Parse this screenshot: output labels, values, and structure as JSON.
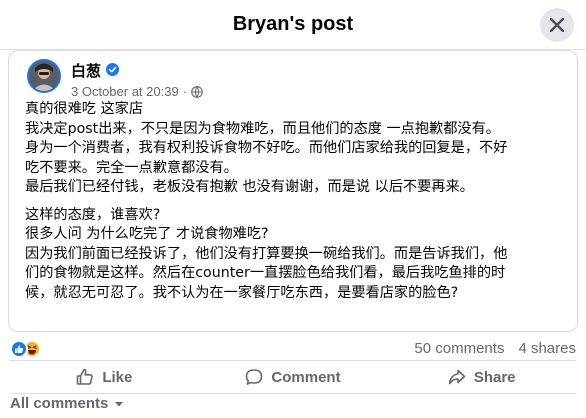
{
  "header": {
    "title": "Bryan's post"
  },
  "post": {
    "author": "白葱",
    "timestamp": "3 October at 20:39",
    "separator": "·",
    "body": [
      [
        "真的很难吃 这家店",
        "我决定post出来，不只是因为食物难吃，而且他们的态度 一点抱歉都没有。",
        "身为一个消费者，我有权利投诉食物不好吃。而他们店家给我的回复是，不好",
        "吃不要来。完全一点歉意都没有。",
        "最后我们已经付钱，老板没有抱歉 也没有谢谢，而是说 以后不要再来。"
      ],
      [
        "这样的态度，谁喜欢?",
        "很多人问 为什么吃完了 才说食物难吃?",
        "因为我们前面已经投诉了，他们没有打算要换一碗给我们。而是告诉我们，他",
        "们的食物就是这样。然后在counter一直摆脸色给我们看，最后我吃鱼排的时",
        "候，就忍无可忍了。我不认为在一家餐厅吃东西，是要看店家的脸色?"
      ]
    ]
  },
  "stats": {
    "comments": "50 comments",
    "shares": "4 shares"
  },
  "actions": {
    "like": "Like",
    "comment": "Comment",
    "share": "Share"
  },
  "comments_filter": {
    "label": "All comments"
  },
  "colors": {
    "brand_blue": "#1877f2",
    "muted": "#65676b",
    "text": "#050505",
    "haha_yellow": "#f7b125"
  },
  "icons": [
    "close-icon",
    "verified-badge-icon",
    "globe-icon",
    "like-reaction-icon",
    "haha-reaction-icon",
    "thumbs-up-icon",
    "comment-bubble-icon",
    "share-arrow-icon",
    "caret-down-icon"
  ]
}
